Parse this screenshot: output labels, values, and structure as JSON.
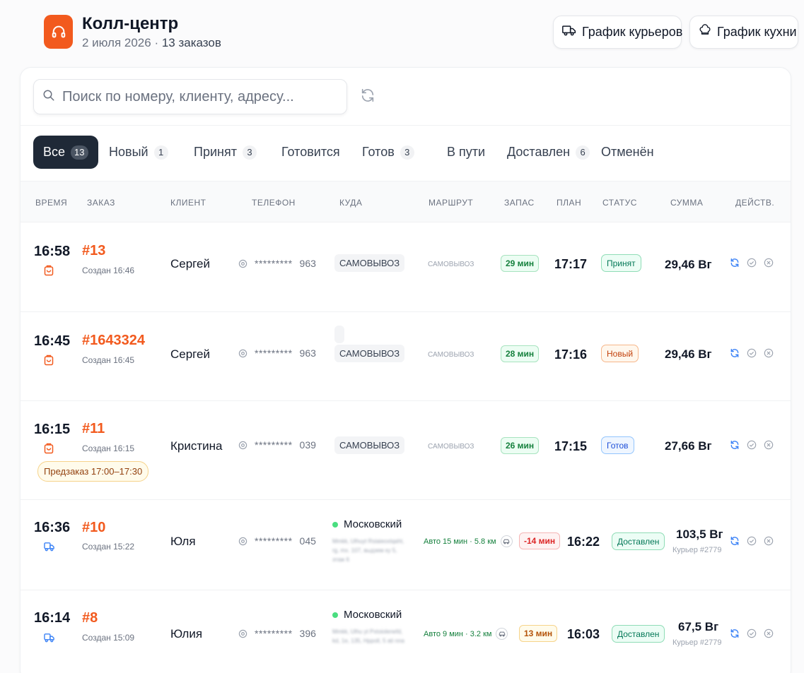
{
  "header": {
    "title": "Колл-центр",
    "date": "2 июля 2026",
    "separator": " · ",
    "orders_count": "13 заказов",
    "couriers_button": "График курьеров",
    "kitchen_button": "График кухни"
  },
  "search": {
    "placeholder": "Поиск по номеру, клиенту, адресу..."
  },
  "tabs": [
    {
      "label": "Все",
      "count": "13"
    },
    {
      "label": "Новый",
      "count": "1"
    },
    {
      "label": "Принят",
      "count": "3"
    },
    {
      "label": "Готовится",
      "count": ""
    },
    {
      "label": "Готов",
      "count": "3"
    },
    {
      "label": "В пути",
      "count": ""
    },
    {
      "label": "Доставлен",
      "count": "6"
    },
    {
      "label": "Отменён",
      "count": ""
    }
  ],
  "columns": [
    "ВРЕМЯ",
    "ЗАКАЗ",
    "КЛИЕНТ",
    "ТЕЛЕФОН",
    "КУДА",
    "МАРШРУТ",
    "ЗАПАС",
    "ПЛАН",
    "СТАТУС",
    "СУММА",
    "ДЕЙСТВ."
  ],
  "rows": [
    {
      "time": "16:58",
      "order": "#13",
      "created": "Создан 16:46",
      "client": "Сергей",
      "phone_mask": "*********",
      "phone_tail": "963",
      "dest": "САМОВЫВОЗ",
      "route": "САМОВЫВОЗ",
      "reserve": "29 мин",
      "plan": "17:17",
      "status": "Принят",
      "sum": "29,46 Вг"
    },
    {
      "time": "16:45",
      "order": "#1643324",
      "created": "Создан 16:45",
      "client": "Сергей",
      "phone_mask": "*********",
      "phone_tail": "963",
      "dest": "САМОВЫВОЗ",
      "route": "САМОВЫВОЗ",
      "reserve": "28 мин",
      "plan": "17:16",
      "status": "Новый",
      "sum": "29,46 Вг"
    },
    {
      "time": "16:15",
      "order": "#11",
      "created": "Создан 16:15",
      "client": "Кристина",
      "phone_mask": "*********",
      "phone_tail": "039",
      "dest": "САМОВЫВОЗ",
      "route": "САМОВЫВОЗ",
      "reserve": "26 мин",
      "plan": "17:15",
      "status": "Готов",
      "sum": "27,66 Вг",
      "preorder": "Предзаказ 17:00–17:30"
    },
    {
      "time": "16:36",
      "order": "#10",
      "created": "Создан 15:22",
      "client": "Юля",
      "phone_mask": "*********",
      "phone_tail": "045",
      "district": "Московский",
      "address": "Mmkk, Ulhuyt Rsiaieoxtqaht, rg, mx. 107, выдзем ку 5, этаж 6",
      "route": "Авто 15 мин · 5.8 км",
      "reserve": "-14 мин",
      "plan": "16:22",
      "status": "Доставлен",
      "sum": "103,5 Вг",
      "courier": "Курьер #2779"
    },
    {
      "time": "16:14",
      "order": "#8",
      "created": "Создан 15:09",
      "client": "Юлия",
      "phone_mask": "*********",
      "phone_tail": "396",
      "district": "Московский",
      "address": "Mmkk, Ulhu yt Pxtoiolenefd, kd, 1e, 135, Hppoll, 5 ati nna",
      "route": "Авто 9 мин · 3.2 км",
      "reserve": "13 мин",
      "plan": "16:03",
      "status": "Доставлен",
      "sum": "67,5 Вг",
      "courier": "Курьер #2779"
    }
  ]
}
